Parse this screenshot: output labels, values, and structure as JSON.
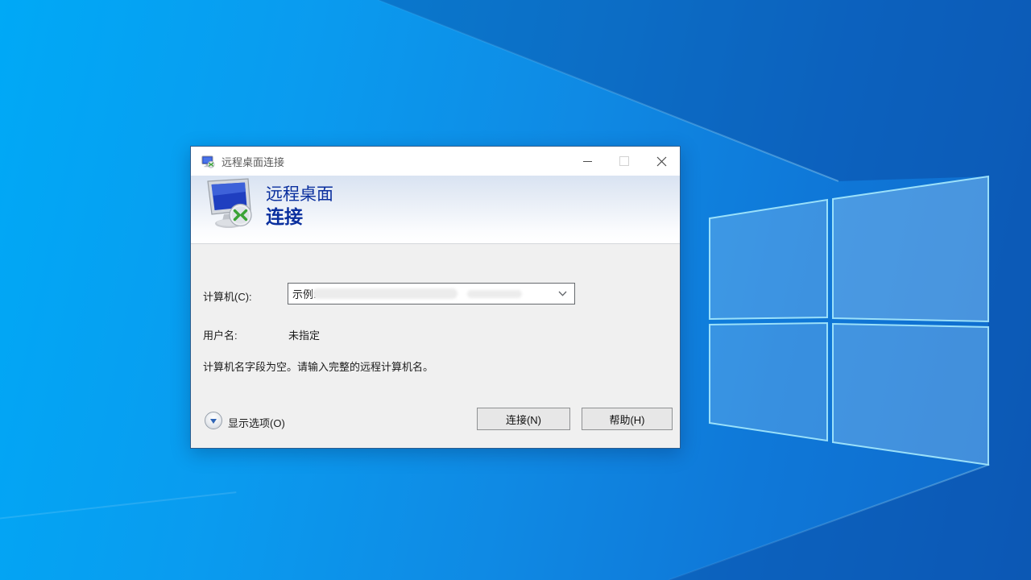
{
  "window": {
    "title": "远程桌面连接"
  },
  "banner": {
    "title_line1": "远程桌面",
    "title_line2": "连接"
  },
  "form": {
    "computer_label": "计算机(C):",
    "computer_value": "示例:",
    "username_label": "用户名:",
    "username_value": "未指定",
    "status_message": "计算机名字段为空。请输入完整的远程计算机名。"
  },
  "footer": {
    "options_label": "显示选项(O)",
    "connect_label": "连接(N)",
    "help_label": "帮助(H)"
  },
  "colors": {
    "banner_text": "#0a2f9e",
    "dialog_bg": "#f0f0f0",
    "desktop_base": "#0f8ae4",
    "dark_wedge": "rgba(6,46,128,0.30)",
    "logo_edge": "#aef0ff",
    "rdp_green": "#3aa335",
    "rdp_screen_blue": "#2446c8"
  },
  "icons": [
    "rdp-app-icon",
    "rdp-banner-icon",
    "minimize-icon",
    "maximize-icon",
    "close-icon",
    "combo-chevron-icon",
    "options-expander-icon",
    "windows-logo"
  ]
}
